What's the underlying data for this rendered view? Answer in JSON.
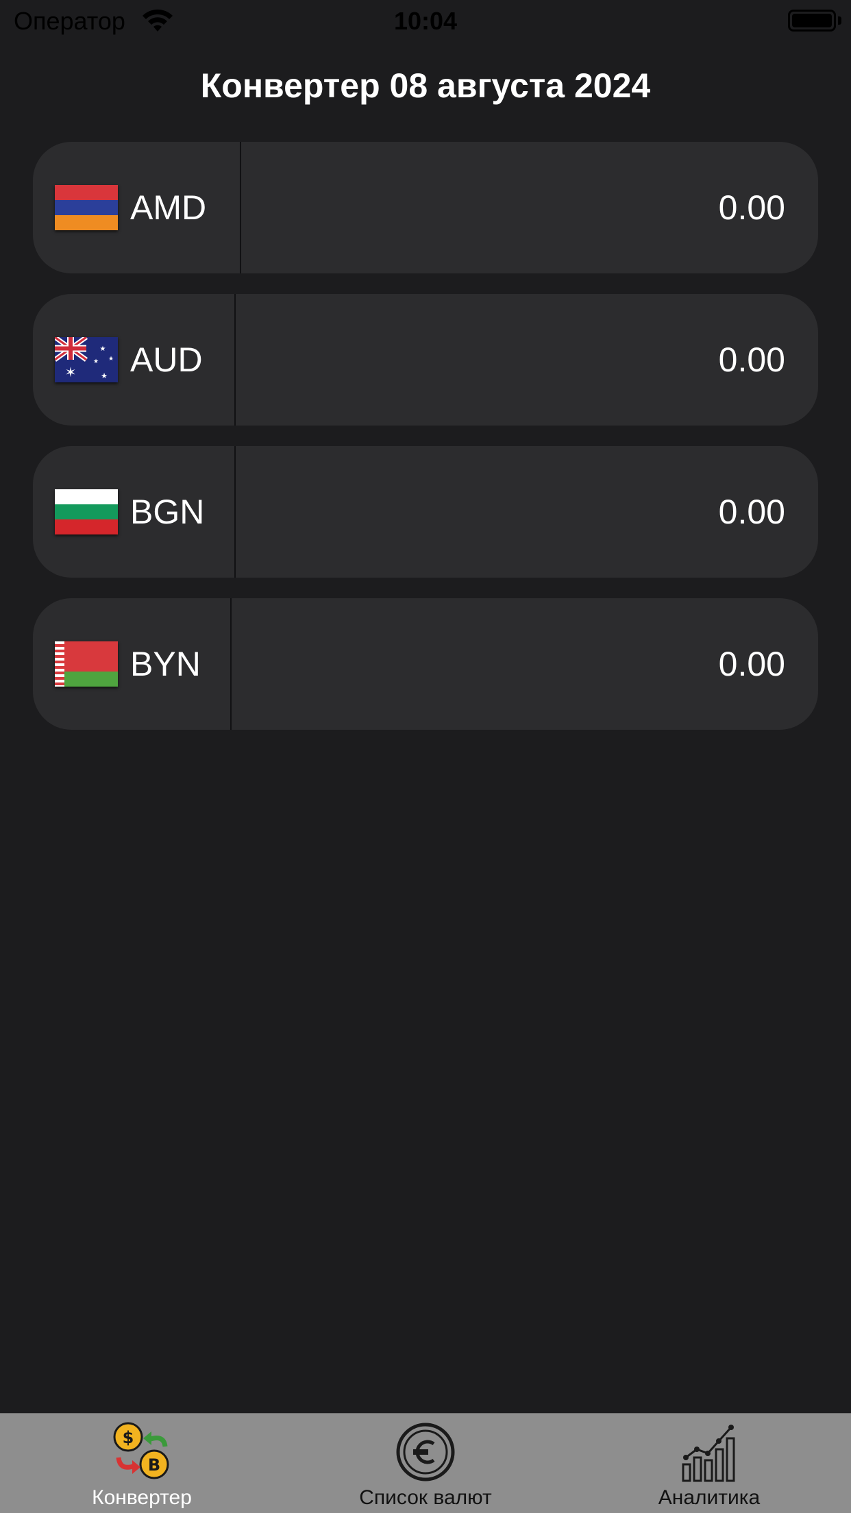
{
  "status_bar": {
    "carrier": "Оператор",
    "time": "10:04"
  },
  "header": {
    "title": "Конвертер 08 августа 2024"
  },
  "currencies": [
    {
      "code": "AMD",
      "amount": "0.00",
      "flag_icon": "armenia-flag-icon"
    },
    {
      "code": "AUD",
      "amount": "0.00",
      "flag_icon": "australia-flag-icon"
    },
    {
      "code": "BGN",
      "amount": "0.00",
      "flag_icon": "bulgaria-flag-icon"
    },
    {
      "code": "BYN",
      "amount": "0.00",
      "flag_icon": "belarus-flag-icon"
    }
  ],
  "tab_bar": {
    "tabs": [
      {
        "label": "Конвертер",
        "icon": "currency-exchange-icon",
        "active": true
      },
      {
        "label": "Список валют",
        "icon": "euro-coin-icon",
        "active": false
      },
      {
        "label": "Аналитика",
        "icon": "bar-chart-icon",
        "active": false
      }
    ]
  },
  "colors": {
    "background": "#1c1c1e",
    "row_background": "#2c2c2e",
    "tab_bar_background": "#8e8e8e",
    "text": "#ffffff"
  }
}
